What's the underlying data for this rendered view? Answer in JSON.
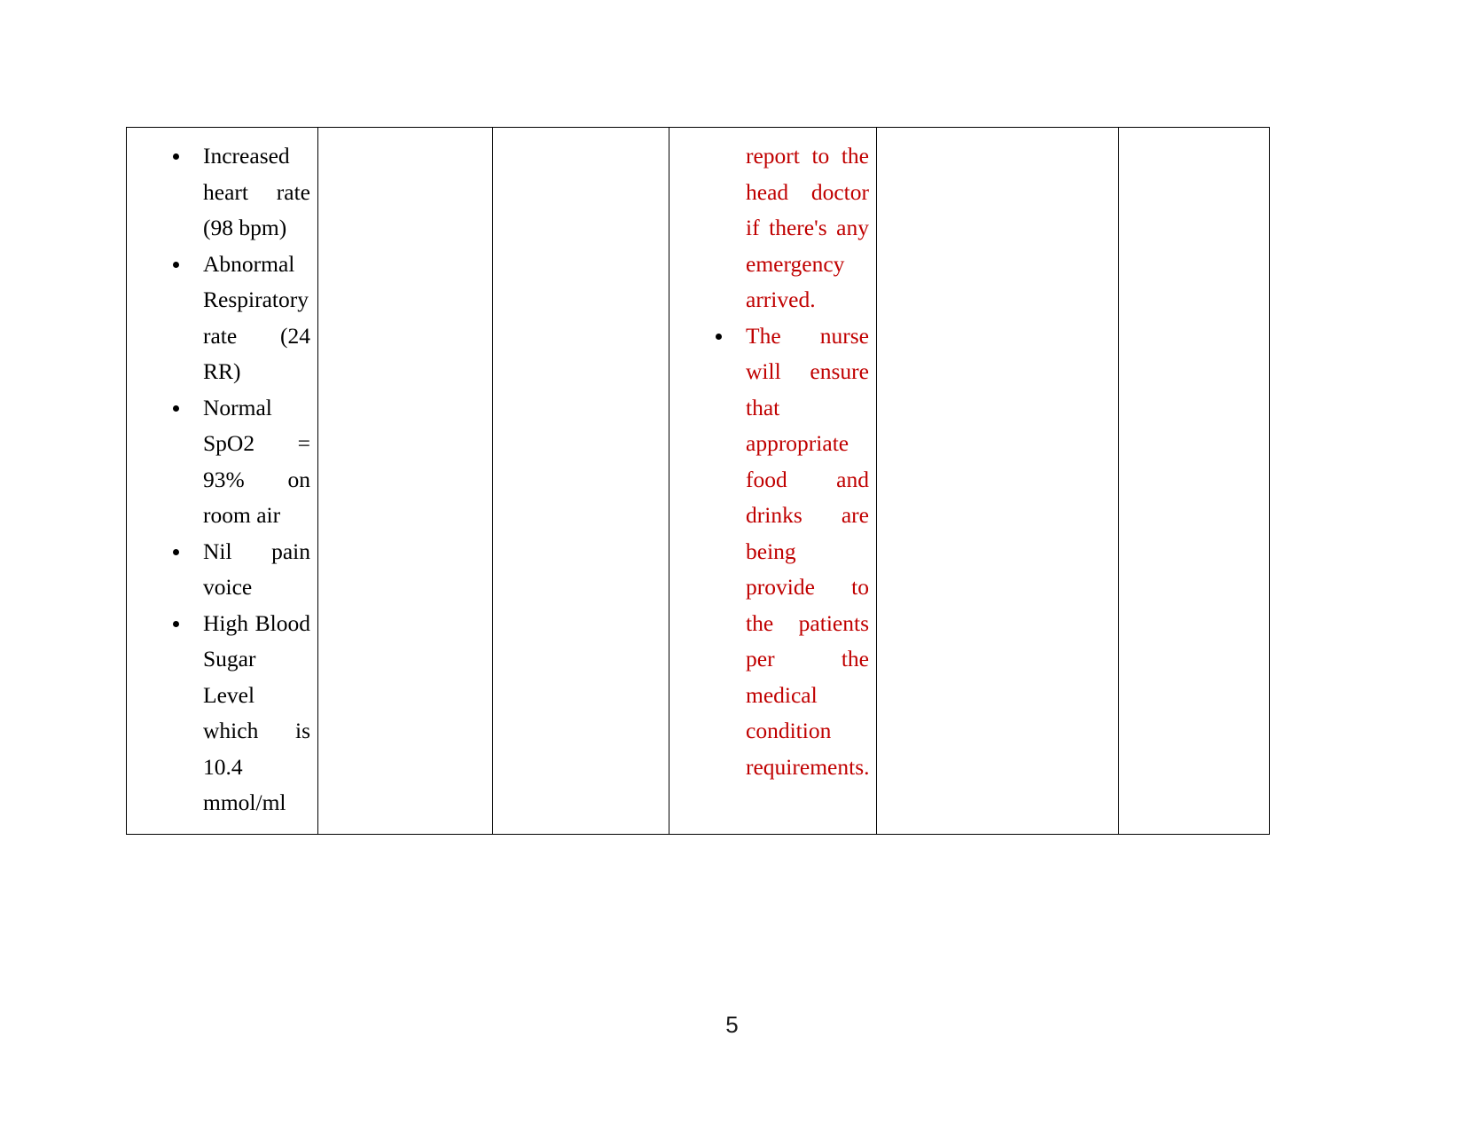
{
  "document": {
    "page_number": "5",
    "colors": {
      "text": "#000000",
      "revision_red": "#C00000",
      "table_border": "#000000",
      "page_background": "#FFFFFF"
    }
  },
  "table": {
    "column_count": 6,
    "row_count": 1,
    "columns": [
      {
        "id": "col-1",
        "content_type": "bulleted-list",
        "color": "#000000"
      },
      {
        "id": "col-2",
        "content_type": "empty",
        "color": "#000000"
      },
      {
        "id": "col-3",
        "content_type": "empty",
        "color": "#000000"
      },
      {
        "id": "col-4",
        "content_type": "bulleted-list",
        "color": "#C00000"
      },
      {
        "id": "col-5",
        "content_type": "empty",
        "color": "#000000"
      },
      {
        "id": "col-6",
        "content_type": "empty",
        "color": "#000000"
      }
    ],
    "cell_1_bullets": [
      "Increased heart rate (98 bpm)",
      "Abnormal Respiratory rate (24 RR)",
      "Normal SpO2 = 93% on room air",
      "Nil pain voice",
      "High Blood Sugar Level which is 10.4 mmol/ml"
    ],
    "cell_4_continued_text": "report to the head doctor if there's any emergency arrived.",
    "cell_4_bullets": [
      "The nurse will ensure that appropriate food and drinks are being provide to the patients per the medical condition requirements."
    ]
  }
}
